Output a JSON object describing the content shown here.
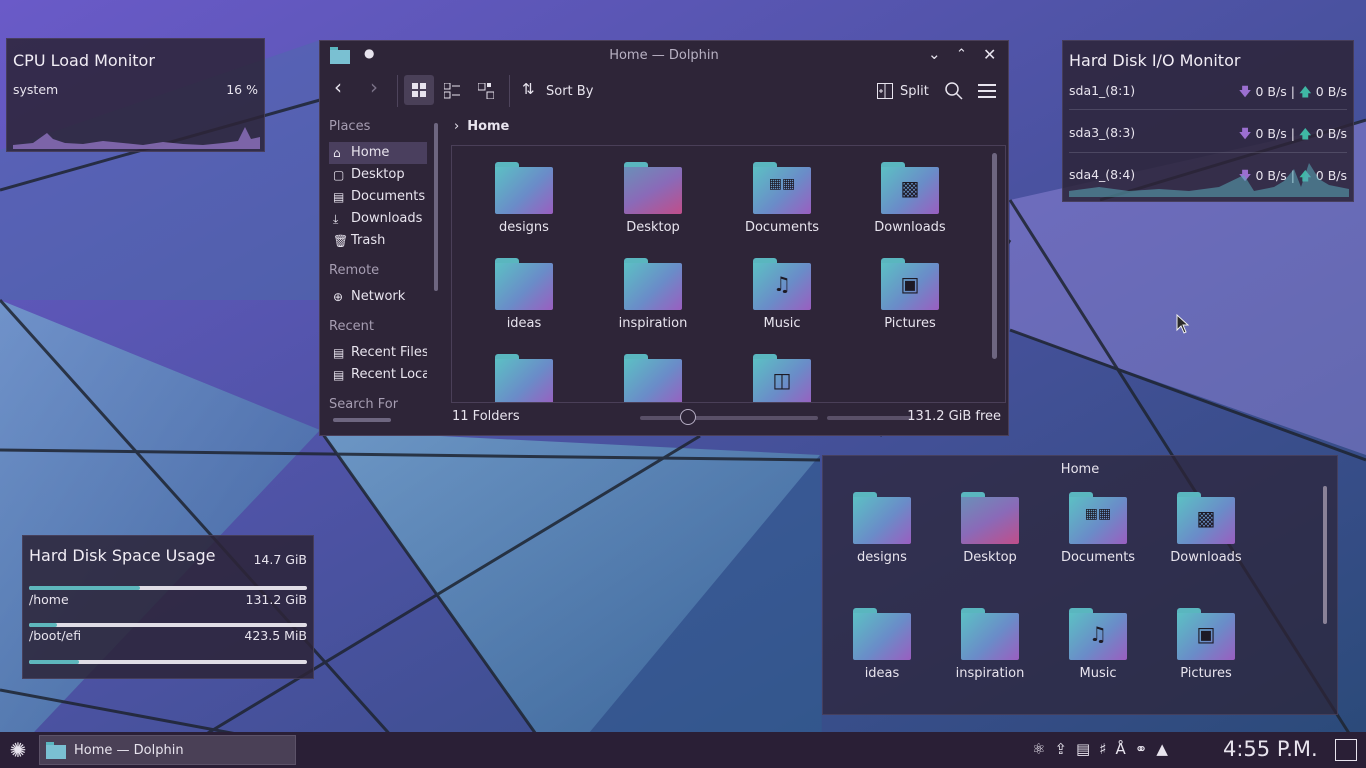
{
  "cpu_monitor": {
    "title": "CPU Load Monitor",
    "label": "system",
    "value": "16 %"
  },
  "io_monitor": {
    "title": "Hard Disk I/O Monitor",
    "rows": [
      {
        "device": "sda1_(8:1)",
        "read": "0 B/s",
        "separator": "|",
        "write": "0 B/s"
      },
      {
        "device": "sda3_(8:3)",
        "read": "0 B/s",
        "separator": "|",
        "write": "0 B/s"
      },
      {
        "device": "sda4_(8:4)",
        "read": "0 B/s",
        "separator": "|",
        "write": "0 B/s"
      }
    ]
  },
  "disk_space": {
    "title": "Hard Disk Space Usage",
    "total": "14.7 GiB",
    "rows": [
      {
        "mount": "/home",
        "free": "131.2 GiB"
      },
      {
        "mount": "/boot/efi",
        "free": "423.5 MiB"
      }
    ],
    "usage_fractions": [
      0.4,
      0.1,
      0.18
    ]
  },
  "dolphin": {
    "title": "Home — Dolphin",
    "toolbar": {
      "sort_label": "Sort By",
      "split_label": "Split"
    },
    "sidebar": {
      "places_header": "Places",
      "places": [
        "Home",
        "Desktop",
        "Documents",
        "Downloads",
        "Trash"
      ],
      "remote_header": "Remote",
      "remote": [
        "Network"
      ],
      "recent_header": "Recent",
      "recent": [
        "Recent Files",
        "Recent Locations"
      ],
      "search_header": "Search For"
    },
    "breadcrumb": "Home",
    "folders": [
      "designs",
      "Desktop",
      "Documents",
      "Downloads",
      "ideas",
      "inspiration",
      "Music",
      "Pictures",
      "",
      "",
      ""
    ],
    "status": "11 Folders",
    "free_space": "131.2 GiB free"
  },
  "folder_view": {
    "title": "Home",
    "folders": [
      "designs",
      "Desktop",
      "Documents",
      "Downloads",
      "ideas",
      "inspiration",
      "Music",
      "Pictures"
    ]
  },
  "taskbar": {
    "task_label": "Home — Dolphin",
    "clock": "4:55 P.M."
  },
  "colors": {
    "accent": "#5eb7bd",
    "panel": "#2e2538",
    "download": "#9b6fd0",
    "upload": "#3fb7a4"
  }
}
